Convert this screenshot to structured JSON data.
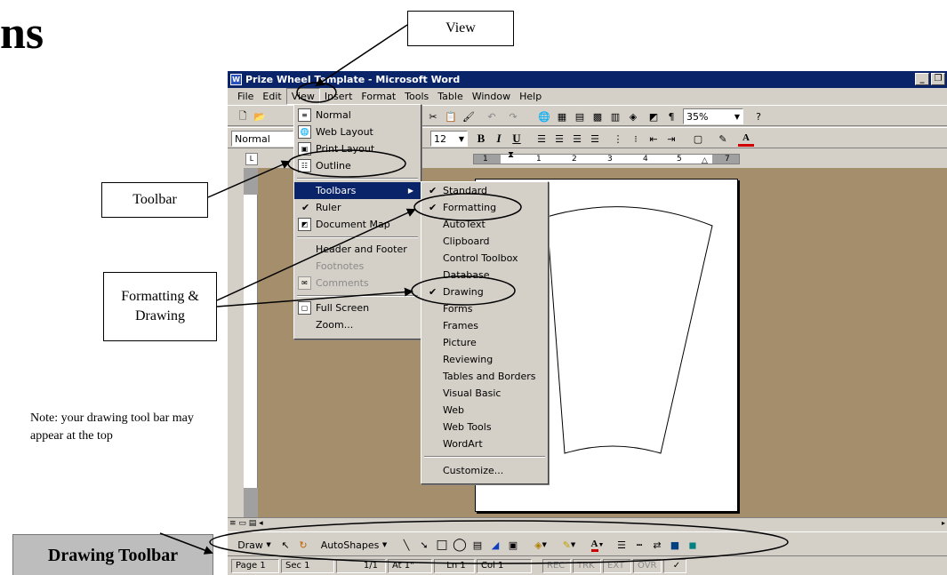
{
  "slide": {
    "title_fragment": "ns",
    "callouts": {
      "view": "View",
      "toolbar": "Toolbar",
      "formatting_drawing": "Formatting & Drawing"
    },
    "note": "Note:  your drawing tool bar may appear at the top",
    "drawing_toolbar_label": "Drawing Toolbar"
  },
  "window": {
    "title": "Prize Wheel Template - Microsoft Word",
    "app_icon": "word-icon",
    "controls": [
      "minimize-icon",
      "restore-icon"
    ]
  },
  "menubar": {
    "items": [
      "File",
      "Edit",
      "View",
      "Insert",
      "Format",
      "Tools",
      "Table",
      "Window",
      "Help"
    ],
    "active": "View"
  },
  "standard_toolbar": {
    "zoom": "35%",
    "icons": [
      "new-icon",
      "open-icon",
      "paste-icon",
      "format-painter-icon",
      "undo-icon",
      "redo-icon",
      "hyperlink-icon",
      "tables-borders-icon",
      "insert-table-icon",
      "insert-excel-icon",
      "columns-icon",
      "drawing-icon",
      "document-map-icon",
      "show-hide-icon",
      "help-icon"
    ],
    "show_hide_glyph": "¶"
  },
  "formatting_toolbar": {
    "style": "Normal",
    "font_size": "12",
    "bold": "B",
    "italic": "I",
    "underline": "U",
    "font_color_glyph": "A"
  },
  "ruler_labels": [
    "1",
    "1",
    "2",
    "3",
    "4",
    "5",
    "7"
  ],
  "view_menu": {
    "items": [
      {
        "label": "Normal",
        "icon": "normal-view-icon"
      },
      {
        "label": "Web Layout",
        "icon": "web-layout-icon"
      },
      {
        "label": "Print Layout",
        "icon": "print-layout-icon"
      },
      {
        "label": "Outline",
        "icon": "outline-view-icon"
      },
      {
        "label": "Toolbars",
        "highlighted": true
      },
      {
        "label": "Ruler",
        "checked": true
      },
      {
        "label": "Document Map",
        "icon": "document-map-icon"
      },
      {
        "label": "Header and Footer"
      },
      {
        "label": "Footnotes",
        "disabled": true
      },
      {
        "label": "Comments",
        "disabled": true,
        "icon": "comments-icon"
      },
      {
        "label": "Full Screen",
        "icon": "full-screen-icon"
      },
      {
        "label": "Zoom..."
      }
    ]
  },
  "toolbars_submenu": {
    "items": [
      {
        "label": "Standard",
        "checked": true
      },
      {
        "label": "Formatting",
        "checked": true
      },
      {
        "label": "AutoText"
      },
      {
        "label": "Clipboard"
      },
      {
        "label": "Control Toolbox"
      },
      {
        "label": "Database"
      },
      {
        "label": "Drawing",
        "checked": true
      },
      {
        "label": "Forms"
      },
      {
        "label": "Frames"
      },
      {
        "label": "Picture"
      },
      {
        "label": "Reviewing"
      },
      {
        "label": "Tables and Borders"
      },
      {
        "label": "Visual Basic"
      },
      {
        "label": "Web"
      },
      {
        "label": "Web Tools"
      },
      {
        "label": "WordArt"
      },
      {
        "label": "Customize..."
      }
    ]
  },
  "drawing_toolbar": {
    "draw": "Draw",
    "autoshapes": "AutoShapes",
    "font_color_glyph": "A"
  },
  "statusbar": {
    "page": "Page 1",
    "sec": "Sec 1",
    "pages": "1/1",
    "at": "At 1\"",
    "ln": "Ln 1",
    "col": "Col 1",
    "rec": "REC",
    "trk": "TRK",
    "ext": "EXT",
    "ovr": "OVR"
  }
}
